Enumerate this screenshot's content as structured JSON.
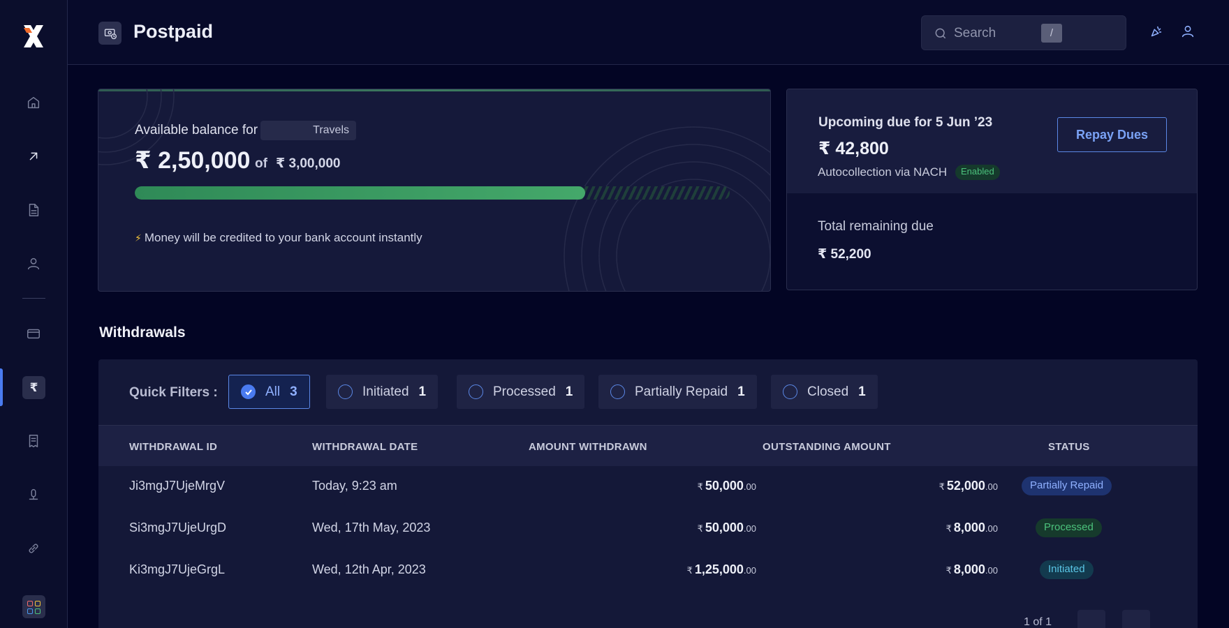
{
  "header": {
    "title": "Postpaid",
    "search_placeholder": "Search",
    "search_shortcut": "/"
  },
  "balance": {
    "label": "Available balance for",
    "account_tag": "Travels",
    "amount": "₹ 2,50,000",
    "of_label": "of",
    "total": "₹ 3,00,000",
    "used_fraction": 0.757,
    "note": "Money will be credited to your bank account instantly"
  },
  "due": {
    "title": "Upcoming due for 5 Jun ’23",
    "amount": "₹ 42,800",
    "autocollection": "Autocollection via NACH",
    "badge": "Enabled",
    "repay_label": "Repay Dues",
    "remaining_label": "Total remaining due",
    "remaining_amount": "₹ 52,200"
  },
  "withdrawals": {
    "title": "Withdrawals",
    "filters_label": "Quick Filters :",
    "filters": [
      {
        "label": "All",
        "count": "3",
        "active": true
      },
      {
        "label": "Initiated",
        "count": "1",
        "active": false
      },
      {
        "label": "Processed",
        "count": "1",
        "active": false
      },
      {
        "label": "Partially Repaid",
        "count": "1",
        "active": false
      },
      {
        "label": "Closed",
        "count": "1",
        "active": false
      }
    ],
    "columns": [
      "WITHDRAWAL ID",
      "WITHDRAWAL DATE",
      "AMOUNT WITHDRAWN",
      "OUTSTANDING AMOUNT",
      "STATUS"
    ],
    "rows": [
      {
        "id": "Ji3mgJ7UjeMrgV",
        "date": "Today, 9:23 am",
        "withdrawn": "50,000",
        "withdrawn_dec": ".00",
        "outstanding": "52,000",
        "outstanding_dec": ".00",
        "status": "Partially Repaid"
      },
      {
        "id": "Si3mgJ7UjeUrgD",
        "date": "Wed, 17th May, 2023",
        "withdrawn": "50,000",
        "withdrawn_dec": ".00",
        "outstanding": "8,000",
        "outstanding_dec": ".00",
        "status": "Processed"
      },
      {
        "id": "Ki3mgJ7UjeGrgL",
        "date": "Wed, 12th Apr, 2023",
        "withdrawn": "1,25,000",
        "withdrawn_dec": ".00",
        "outstanding": "8,000",
        "outstanding_dec": ".00",
        "status": "Initiated"
      }
    ],
    "currency_symbol": "₹",
    "pager": "1 of 1"
  },
  "sidebar": {
    "active_symbol": "₹"
  },
  "colors": {
    "accent": "#4a7bf0",
    "success": "#4cc27c",
    "background": "#030524"
  }
}
